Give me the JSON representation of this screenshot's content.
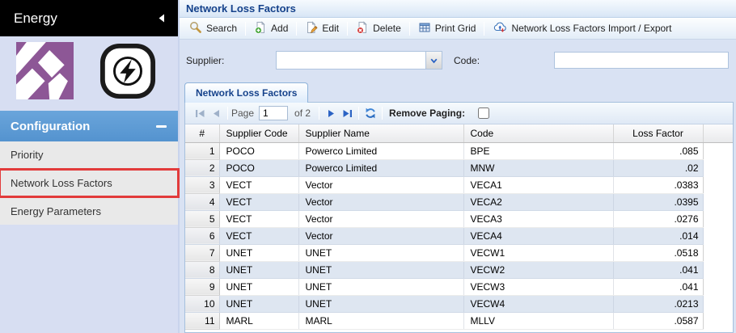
{
  "sidebar": {
    "title": "Energy",
    "section_header": "Configuration",
    "items": [
      {
        "label": "Priority",
        "highlighted": false
      },
      {
        "label": "Network Loss Factors",
        "highlighted": true
      },
      {
        "label": "Energy Parameters",
        "highlighted": false
      }
    ]
  },
  "panel": {
    "title": "Network Loss Factors"
  },
  "toolbar": {
    "search": "Search",
    "add": "Add",
    "edit": "Edit",
    "delete": "Delete",
    "print_grid": "Print Grid",
    "import_export": "Network Loss Factors Import / Export"
  },
  "filters": {
    "supplier_label": "Supplier:",
    "supplier_value": "",
    "code_label": "Code:",
    "code_value": ""
  },
  "tab": {
    "label": "Network Loss Factors"
  },
  "paging": {
    "page_label": "Page",
    "page_value": "1",
    "of_label": "of 2",
    "remove_paging_label": "Remove Paging:",
    "remove_paging_checked": false
  },
  "grid": {
    "columns": [
      "#",
      "Supplier Code",
      "Supplier Name",
      "Code",
      "Loss Factor"
    ],
    "rows": [
      [
        "1",
        "POCO",
        "Powerco Limited",
        "BPE",
        ".085"
      ],
      [
        "2",
        "POCO",
        "Powerco Limited",
        "MNW",
        ".02"
      ],
      [
        "3",
        "VECT",
        "Vector",
        "VECA1",
        ".0383"
      ],
      [
        "4",
        "VECT",
        "Vector",
        "VECA2",
        ".0395"
      ],
      [
        "5",
        "VECT",
        "Vector",
        "VECA3",
        ".0276"
      ],
      [
        "6",
        "VECT",
        "Vector",
        "VECA4",
        ".014"
      ],
      [
        "7",
        "UNET",
        "UNET",
        "VECW1",
        ".0518"
      ],
      [
        "8",
        "UNET",
        "UNET",
        "VECW2",
        ".041"
      ],
      [
        "9",
        "UNET",
        "UNET",
        "VECW3",
        ".041"
      ],
      [
        "10",
        "UNET",
        "UNET",
        "VECW4",
        ".0213"
      ],
      [
        "11",
        "MARL",
        "MARL",
        "MLLV",
        ".0587"
      ]
    ]
  },
  "colors": {
    "accent_blue": "#15428b",
    "section_header_blue": "#5b9cd6",
    "highlight_red": "#e23b3b",
    "alt_row": "#dee6f1",
    "sidebar_bg": "#d7def2",
    "filter_bg": "#d9e2f3"
  }
}
